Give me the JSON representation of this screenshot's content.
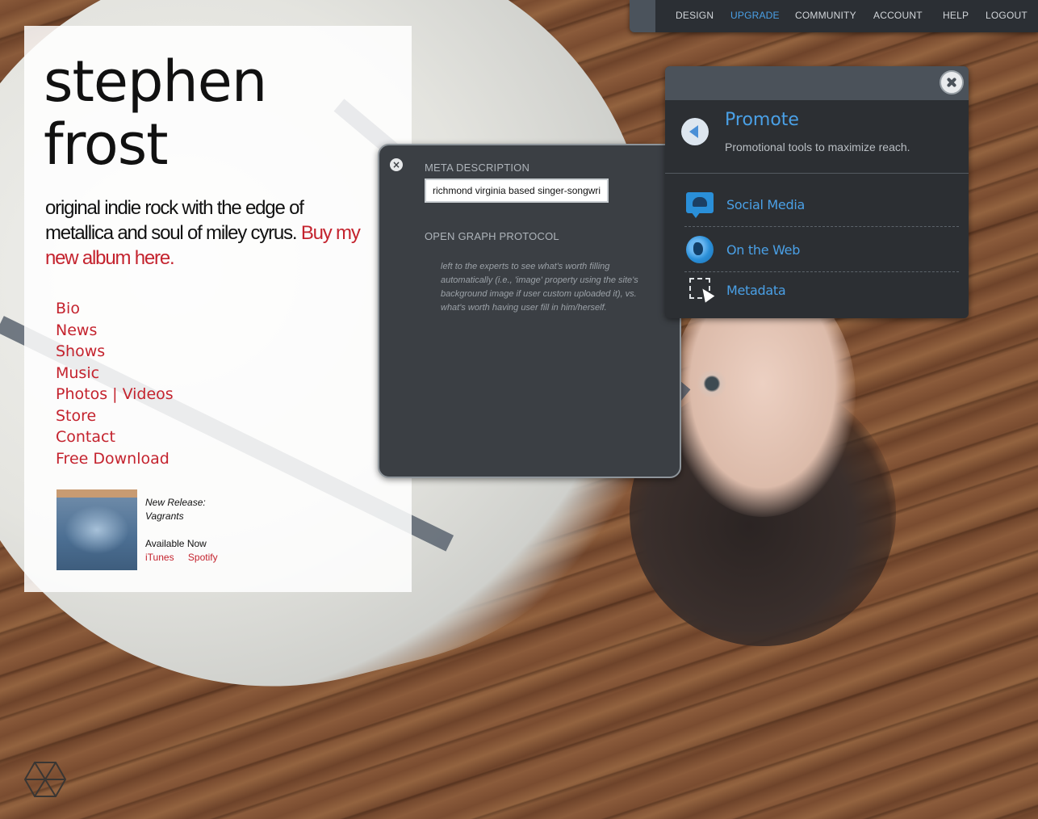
{
  "topnav": {
    "items": [
      {
        "label": "DESIGN"
      },
      {
        "label": "UPGRADE"
      },
      {
        "label": "COMMUNITY"
      },
      {
        "label": "ACCOUNT"
      },
      {
        "label": "HELP"
      },
      {
        "label": "LOGOUT"
      }
    ],
    "active_color": "#4aa0e6"
  },
  "site": {
    "title_line1": "stephen",
    "title_line2": "frost",
    "tagline": "original indie rock with the edge of metallica and soul of miley cyrus.",
    "buy_link": "Buy my new album here.",
    "nav": [
      {
        "label": "Bio"
      },
      {
        "label": "News"
      },
      {
        "label": "Shows"
      },
      {
        "label": "Music"
      },
      {
        "label": "Photos | Videos"
      },
      {
        "label": "Store"
      },
      {
        "label": "Contact"
      },
      {
        "label": "Free Download"
      }
    ],
    "release": {
      "heading": "New Release:",
      "album": "Vagrants",
      "availability": "Available Now",
      "links": [
        "iTunes",
        "Spotify"
      ]
    },
    "accent_color": "#c4232e"
  },
  "meta_panel": {
    "description_label": "META DESCRIPTION",
    "description_value": "richmond virginia based singer-songwriter",
    "og_label": "OPEN GRAPH PROTOCOL",
    "note": "left to the experts to see what's worth filling automatically (i.e., 'image' property using the site's background image if user custom uploaded it), vs. what's worth having user fill in him/herself."
  },
  "promote": {
    "title": "Promote",
    "subtitle": "Promotional tools to maximize reach.",
    "items": [
      {
        "label": "Social Media",
        "icon": "social-media-icon"
      },
      {
        "label": "On the Web",
        "icon": "globe-icon"
      },
      {
        "label": "Metadata",
        "icon": "metadata-cursor-icon"
      }
    ]
  }
}
